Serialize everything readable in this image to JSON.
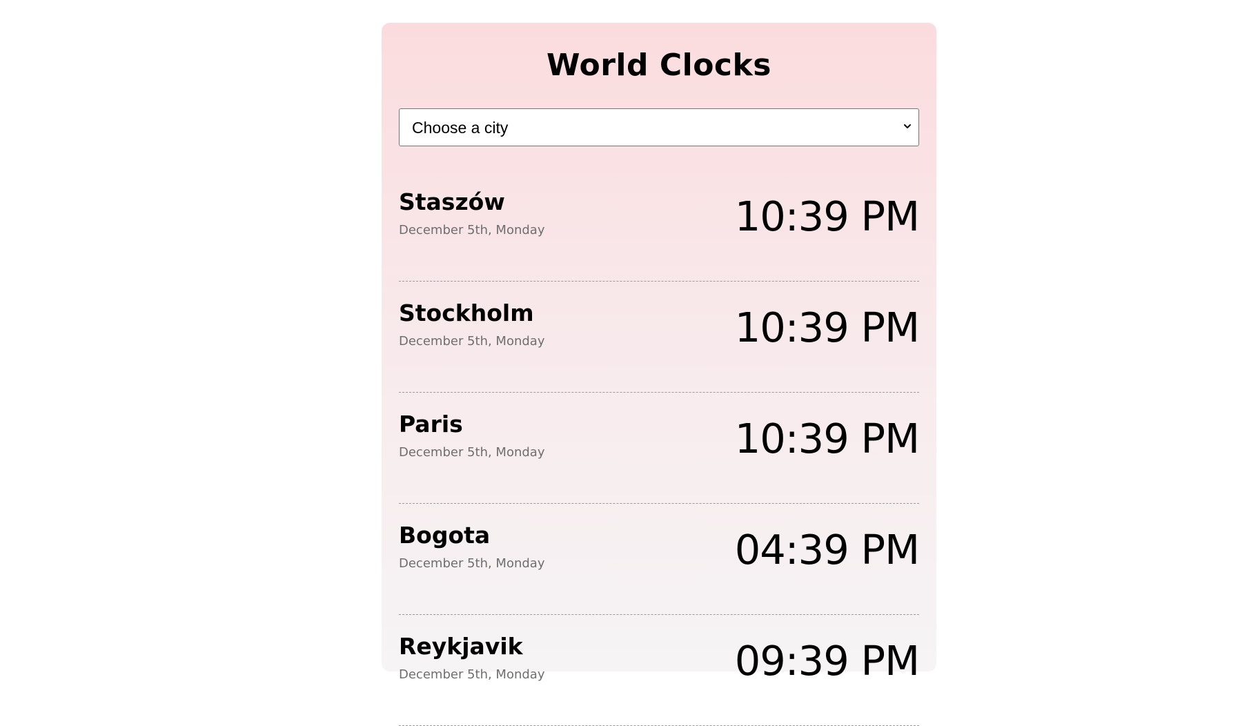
{
  "app": {
    "title": "World Clocks"
  },
  "city_select": {
    "selected": "Choose a city",
    "icon": "chevron-down-icon"
  },
  "cities": [
    {
      "name": "Staszów",
      "date": "December 5th, Monday",
      "time": "10:39 PM"
    },
    {
      "name": "Stockholm",
      "date": "December 5th, Monday",
      "time": "10:39 PM"
    },
    {
      "name": "Paris",
      "date": "December 5th, Monday",
      "time": "10:39 PM"
    },
    {
      "name": "Bogota",
      "date": "December 5th, Monday",
      "time": "04:39 PM"
    },
    {
      "name": "Reykjavik",
      "date": "December 5th, Monday",
      "time": "09:39 PM"
    }
  ],
  "colors": {
    "card_top": "#fbdcde",
    "card_bottom": "#f6f4f5",
    "date_text": "#6e6e6e",
    "divider": "#9a9a9a"
  }
}
